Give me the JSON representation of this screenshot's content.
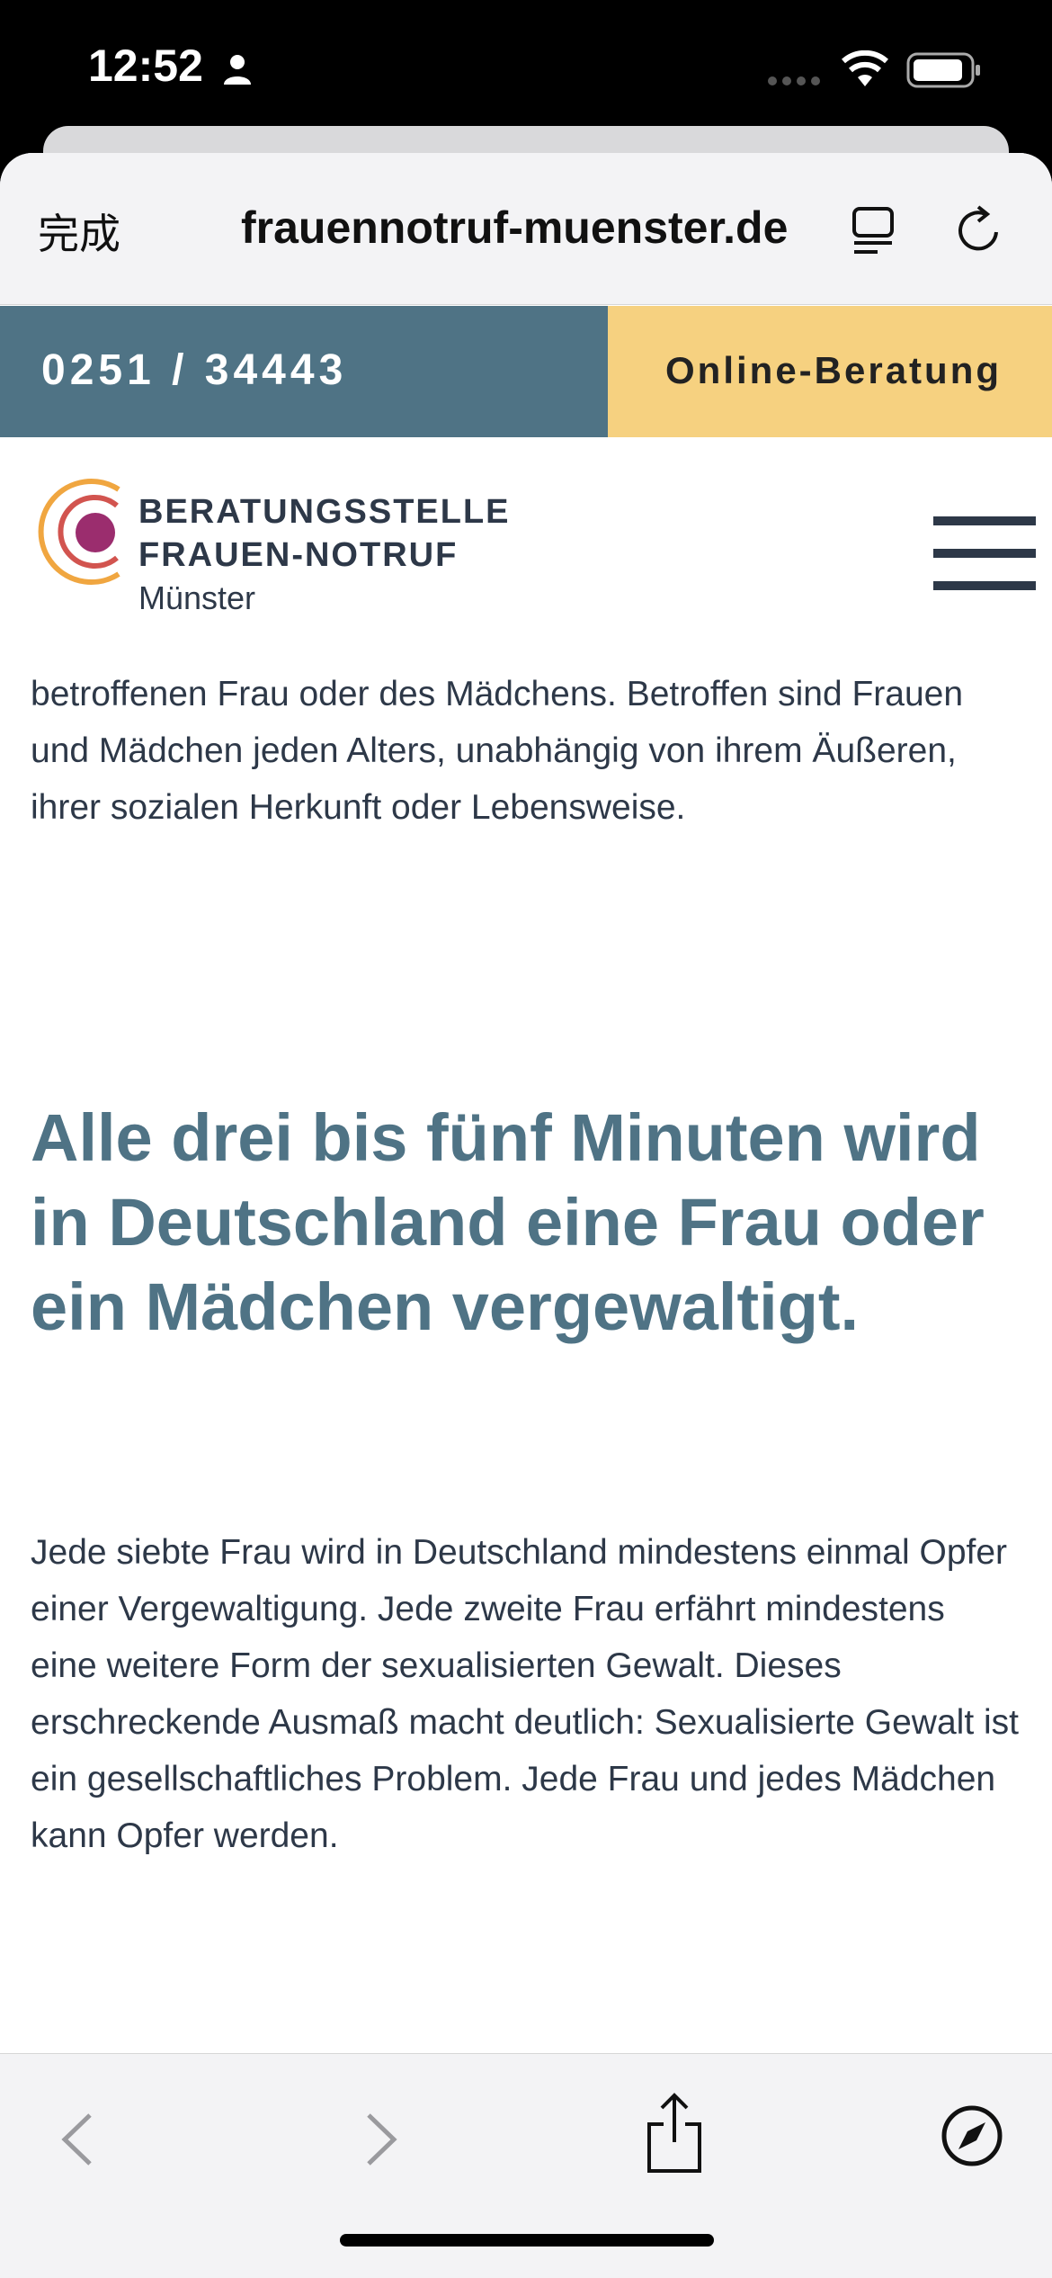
{
  "status_bar": {
    "time": "12:52",
    "icons": [
      "person-icon",
      "signal-icon",
      "wifi-icon",
      "battery-icon"
    ]
  },
  "browser": {
    "done_label": "完成",
    "url": "frauennotruf-muenster.de",
    "icons": [
      "reader-icon",
      "reload-icon"
    ]
  },
  "topbar": {
    "phone": "0251 / 34443",
    "online": "Online-Beratung",
    "colors": {
      "phone_bg": "#4f7385",
      "online_bg": "#f6d180"
    }
  },
  "header": {
    "logo_line1": "BERATUNGSSTELLE",
    "logo_line2": "FRAUEN-NOTRUF",
    "logo_line3": "Münster",
    "menu_icon": "hamburger-menu-icon"
  },
  "main": {
    "para1": "betroffenen Frau oder des Mädchens. Betroffen sind Frauen und Mädchen jeden Alters, unabhängig von ihrem Äußeren, ihrer sozialen Herkunft oder Lebensweise.",
    "headline": "Alle drei bis fünf Minuten wird in Deutschland eine Frau oder ein Mädchen vergewaltigt.",
    "para2": "Jede siebte Frau wird in Deutschland mindestens einmal Opfer einer Vergewaltigung. Jede zweite Frau erfährt mindestens eine weitere Form der sexualisierten Gewalt. Dieses erschreckende Ausmaß macht deutlich: Sexualisierte Gewalt ist ein gesellschaftliches Problem. Jede Frau und jedes Mädchen kann Opfer werden."
  },
  "toolbar": {
    "icons": [
      "back-icon",
      "forward-icon",
      "share-icon",
      "compass-icon"
    ]
  }
}
